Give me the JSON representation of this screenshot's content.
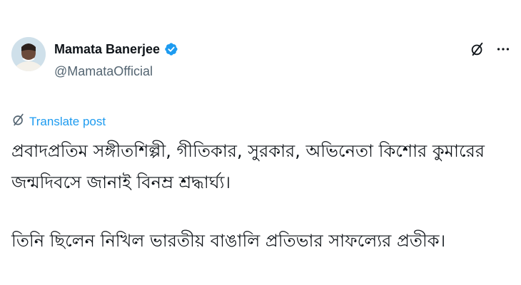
{
  "author": {
    "display_name": "Mamata Banerjee",
    "handle": "@MamataOfficial",
    "verified": true
  },
  "icons": {
    "verified": "verified-badge-icon",
    "grok": "grok-icon",
    "more": "more-icon",
    "translate": "translate-icon"
  },
  "translate": {
    "label": "Translate post"
  },
  "post": {
    "line1": "প্রবাদপ্রতিম সঙ্গীতশিল্পী, গীতিকার, সুরকার, অভিনেতা কিশোর কুমারের",
    "line2": "জন্মদিবসে জানাই বিনম্র শ্রদ্ধার্ঘ্য।",
    "line3": "তিনি ছিলেন নিখিল ভারতীয় বাঙালি প্রতিভার সাফল্যের প্রতীক।"
  },
  "colors": {
    "accent": "#1d9bf0",
    "text_primary": "#0f1419",
    "text_secondary": "#536471"
  }
}
